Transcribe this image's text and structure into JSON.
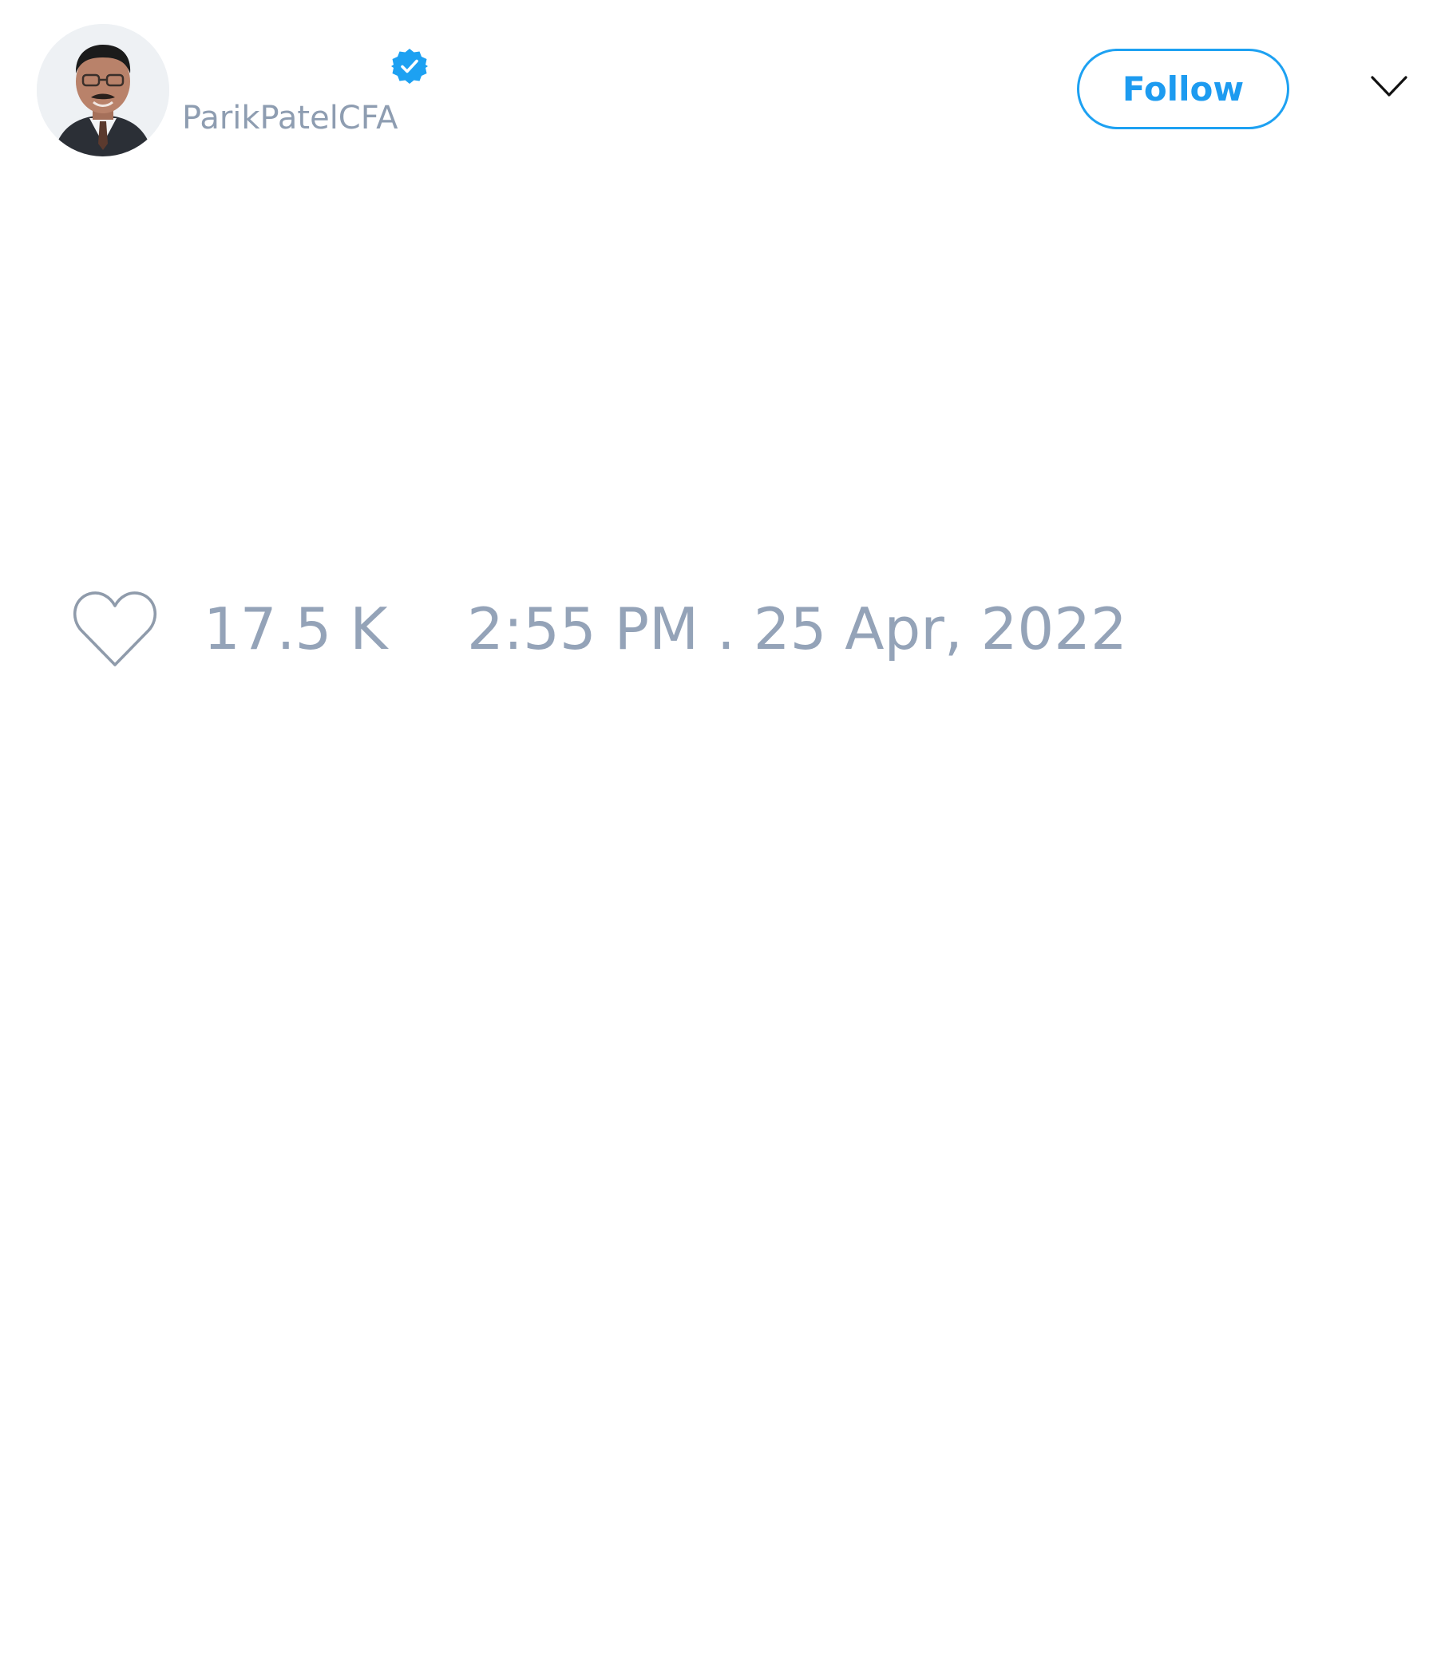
{
  "header": {
    "username": "ParikPatelCFA",
    "verified": true,
    "follow_label": "Follow",
    "avatar_icon": "user-photo",
    "menu_icon": "chevron-down-icon"
  },
  "meta": {
    "like_icon": "heart-icon",
    "like_count": "17.5 K",
    "timestamp": "2:55 PM . 25 Apr, 2022"
  },
  "colors": {
    "accent": "#1da1f2",
    "muted_text": "#94a3b8",
    "background": "#ffffff"
  }
}
